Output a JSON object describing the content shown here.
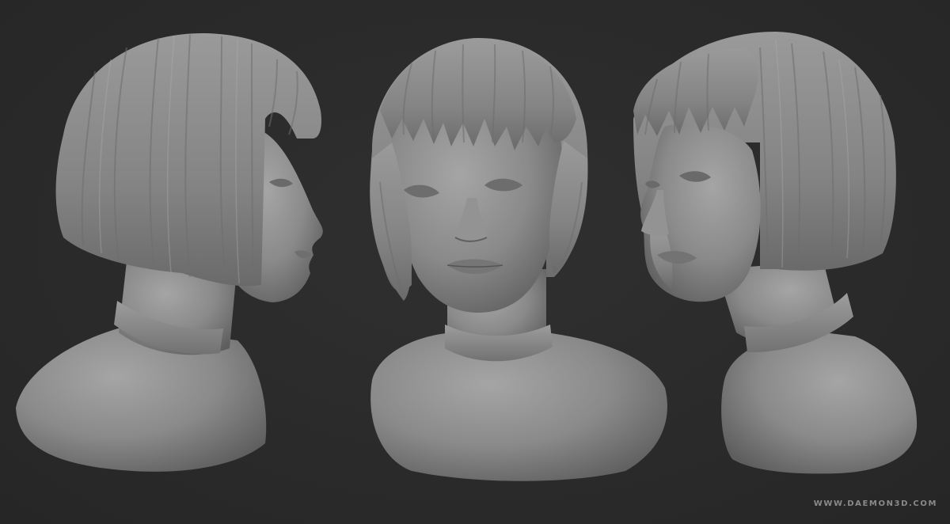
{
  "scene": {
    "background": "#2b2b2b",
    "material_color": "#8c8c8c",
    "views": [
      "left-profile",
      "front",
      "right-three-quarter"
    ]
  },
  "watermark": {
    "text": "WWW.DAEMON3D.COM"
  }
}
